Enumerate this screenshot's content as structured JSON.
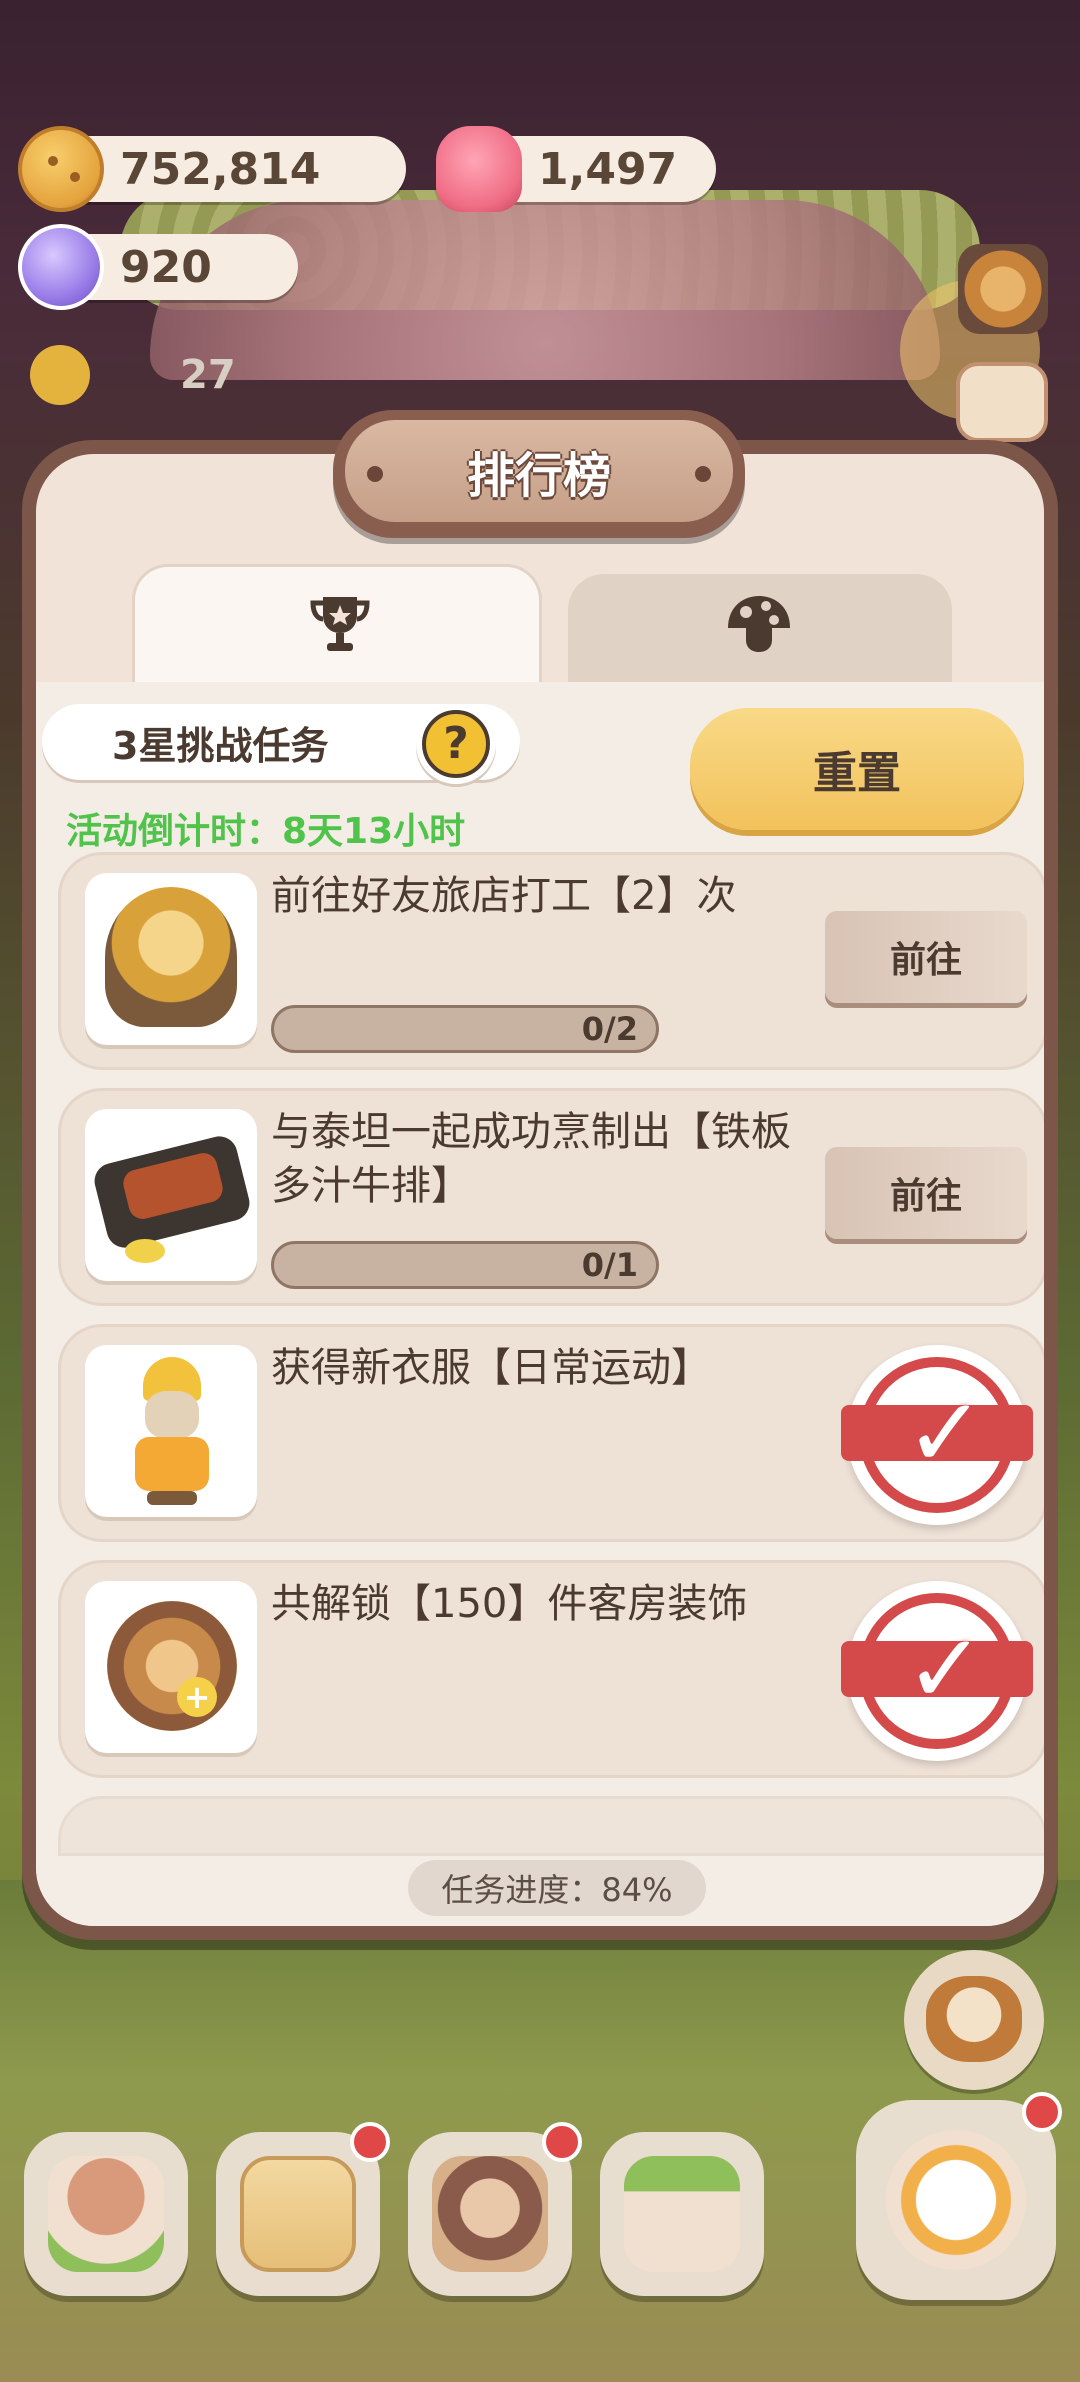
{
  "currencies": {
    "cookies": "752,814",
    "jelly": "1,497",
    "candy": "920"
  },
  "counter_value": "27",
  "panel": {
    "title": "排行榜",
    "tabs": [
      {
        "icon": "trophy-icon",
        "active": true
      },
      {
        "icon": "mushroom-icon",
        "active": false
      }
    ],
    "task_set_label": "3星挑战任务",
    "help_symbol": "?",
    "reset_label": "重置",
    "countdown": "活动倒计时：8天13小时",
    "tasks": [
      {
        "title": "前往好友旅店打工【2】次",
        "progress": "0/2",
        "progress_fraction": 0,
        "action": "前往",
        "done": false
      },
      {
        "title": "与泰坦一起成功烹制出【铁板多汁牛排】",
        "progress": "0/1",
        "progress_fraction": 0,
        "action": "前往",
        "done": false
      },
      {
        "title": "获得新衣服【日常运动】",
        "done": true
      },
      {
        "title": "共解锁【150】件客房装饰",
        "done": true
      }
    ],
    "task_progress": "任务进度：84%"
  },
  "colors": {
    "countdown": "#4fc34a",
    "stamp": "#d44a4a",
    "reset_button": "#f2c25c"
  }
}
